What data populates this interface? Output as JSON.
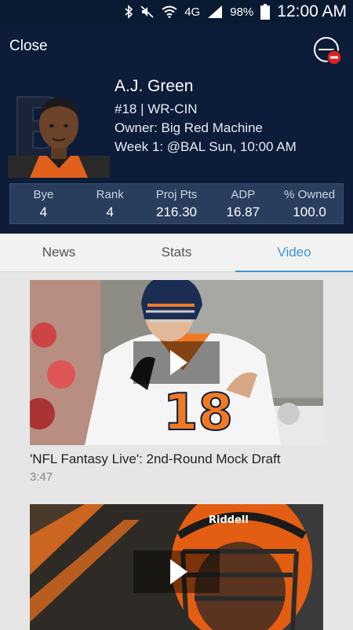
{
  "status_bar": {
    "battery": "98%",
    "time": "12:00 AM",
    "network": "4G"
  },
  "header": {
    "close_label": "Close",
    "player": {
      "name": "A.J. Green",
      "number_position": "#18 | WR-CIN",
      "owner": "Owner: Big Red Machine",
      "matchup": "Week 1: @BAL Sun, 10:00 AM"
    },
    "stats": [
      {
        "label": "Bye",
        "value": "4"
      },
      {
        "label": "Rank",
        "value": "4"
      },
      {
        "label": "Proj Pts",
        "value": "216.30"
      },
      {
        "label": "ADP",
        "value": "16.87"
      },
      {
        "label": "% Owned",
        "value": "100.0"
      }
    ]
  },
  "tabs": [
    {
      "label": "News",
      "active": false
    },
    {
      "label": "Stats",
      "active": false
    },
    {
      "label": "Video",
      "active": true
    }
  ],
  "videos": [
    {
      "title": "'NFL Fantasy Live': 2nd-Round Mock Draft",
      "duration": "3:47",
      "jersey_number": "18"
    },
    {
      "title": "",
      "duration": "",
      "helmet_brand": "Riddell"
    }
  ],
  "colors": {
    "header_bg": "#0c1c39",
    "accent": "#3d93cf",
    "remove_red": "#e02020"
  }
}
